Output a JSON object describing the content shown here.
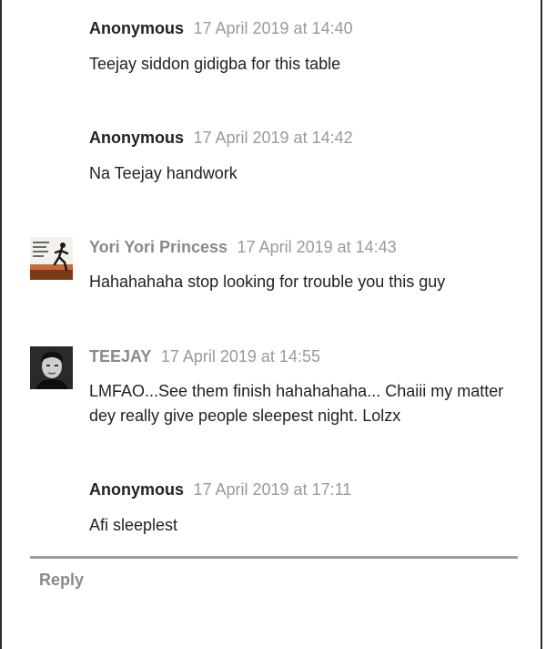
{
  "comments": [
    {
      "author": "Anonymous",
      "date": "17 April 2019 at 14:40",
      "text": "Teejay siddon gidigba for this table"
    },
    {
      "author": "Anonymous",
      "date": "17 April 2019 at 14:42",
      "text": "Na Teejay handwork"
    },
    {
      "author": "Yori Yori Princess",
      "date": "17 April 2019 at 14:43",
      "text": "Hahahahaha stop looking for trouble you this guy",
      "avatar": "runner-photo-avatar"
    },
    {
      "author": "TEEJAY",
      "date": "17 April 2019 at 14:55",
      "text": "LMFAO...See them finish hahahahaha... Chaiii my matter dey really give people sleepest night. Lolzx",
      "avatar": "man-photo-avatar"
    },
    {
      "author": "Anonymous",
      "date": "17 April 2019 at 17:11",
      "text": "Afi sleeplest"
    }
  ],
  "reply_label": "Reply"
}
